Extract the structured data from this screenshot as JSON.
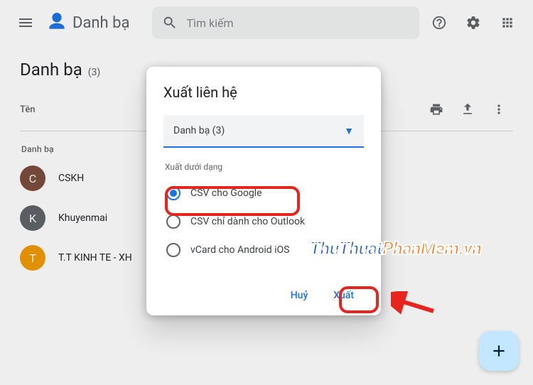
{
  "header": {
    "app_title": "Danh bạ",
    "search_placeholder": "Tìm kiếm"
  },
  "page": {
    "title": "Danh bạ",
    "count_label": "(3)",
    "column_name": "Tên",
    "section_label": "Danh bạ"
  },
  "contacts": [
    {
      "initial": "C",
      "name": "CSKH",
      "color": "#7b4b3a"
    },
    {
      "initial": "K",
      "name": "Khuyenmai",
      "color": "#5f6368"
    },
    {
      "initial": "T",
      "name": "T.T KINH TE - XH",
      "color": "#f29900"
    }
  ],
  "dialog": {
    "title": "Xuất liên hệ",
    "select_value": "Danh bạ (3)",
    "format_label": "Xuất dưới dạng",
    "options": [
      "CSV cho Google",
      "CSV chỉ dành cho Outlook",
      "vCard cho Android iOS"
    ],
    "cancel": "Huỷ",
    "confirm": "Xuất"
  },
  "watermark": {
    "part1": "ThuThuat",
    "part2": "PhanMem.vn"
  }
}
